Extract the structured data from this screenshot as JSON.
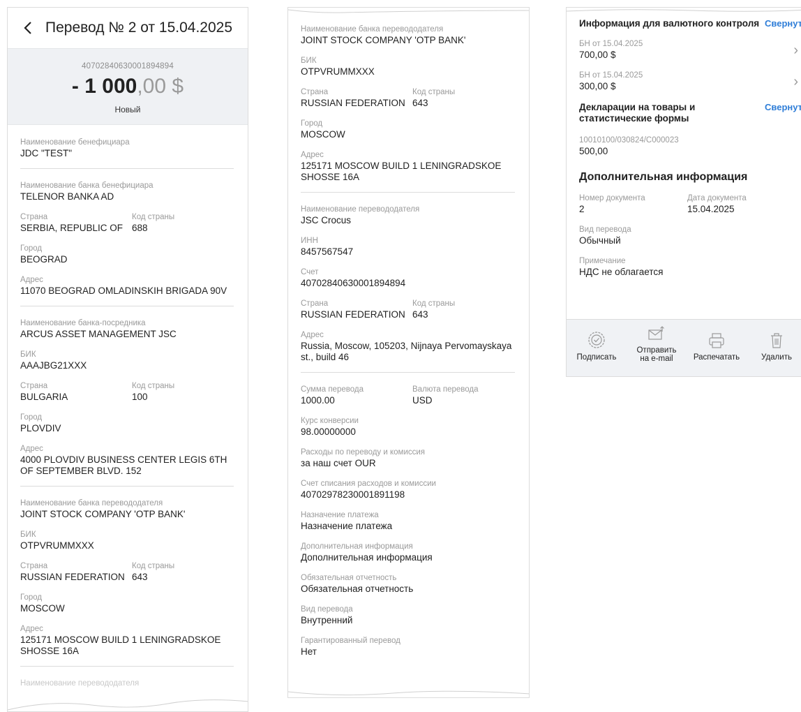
{
  "panel1": {
    "title": "Перевод № 2 от 15.04.2025",
    "account": "40702840630001894894",
    "amount_int": "- 1 000",
    "amount_dec": ",00 $",
    "status": "Новый",
    "beneficiary_name": {
      "label": "Наименование бенефициара",
      "value": "JDC \"TEST\""
    },
    "beneficiary_bank": {
      "name": {
        "label": "Наименование банка бенефициара",
        "value": "TELENOR BANKA AD"
      },
      "country": {
        "label": "Страна",
        "value": "SERBIA, REPUBLIC OF"
      },
      "country_code": {
        "label": "Код страны",
        "value": "688"
      },
      "city": {
        "label": "Город",
        "value": "BEOGRAD"
      },
      "address": {
        "label": "Адрес",
        "value": "11070 BEOGRAD OMLADINSKIH BRIGADA 90V"
      }
    },
    "intermediary_bank": {
      "name": {
        "label": "Наименование банка-посредника",
        "value": "ARCUS ASSET MANAGEMENT JSC"
      },
      "bik": {
        "label": "БИК",
        "value": "AAAJBG21XXX"
      },
      "country": {
        "label": "Страна",
        "value": "BULGARIA"
      },
      "country_code": {
        "label": "Код страны",
        "value": "100"
      },
      "city": {
        "label": "Город",
        "value": "PLOVDIV"
      },
      "address": {
        "label": "Адрес",
        "value": "4000 PLOVDIV BUSINESS CENTER LEGIS 6TH OF SEPTEMBER BLVD. 152"
      }
    },
    "sender_bank": {
      "name": {
        "label": "Наименование банка перевододателя",
        "value": "JOINT STOCK COMPANY 'OTP BANK'"
      },
      "bik": {
        "label": "БИК",
        "value": "OTPVRUMMXXX"
      },
      "country": {
        "label": "Страна",
        "value": "RUSSIAN FEDERATION"
      },
      "country_code": {
        "label": "Код страны",
        "value": "643"
      },
      "city": {
        "label": "Город",
        "value": "MOSCOW"
      },
      "address": {
        "label": "Адрес",
        "value": "125171 MOSCOW BUILD 1 LENINGRADSKOE SHOSSE 16A"
      }
    },
    "next_label": "Наименование перевододателя"
  },
  "panel2": {
    "sender_bank": {
      "name": {
        "label": "Наименование банка перевододателя",
        "value": "JOINT STOCK COMPANY 'OTP BANK'"
      },
      "bik": {
        "label": "БИК",
        "value": "OTPVRUMMXXX"
      },
      "country": {
        "label": "Страна",
        "value": "RUSSIAN FEDERATION"
      },
      "country_code": {
        "label": "Код страны",
        "value": "643"
      },
      "city": {
        "label": "Город",
        "value": "MOSCOW"
      },
      "address": {
        "label": "Адрес",
        "value": "125171 MOSCOW BUILD 1 LENINGRADSKOE SHOSSE 16A"
      }
    },
    "sender": {
      "name": {
        "label": "Наименование перевододателя",
        "value": "JSC Crocus"
      },
      "inn": {
        "label": "ИНН",
        "value": "8457567547"
      },
      "account": {
        "label": "Счет",
        "value": "40702840630001894894"
      },
      "country": {
        "label": "Страна",
        "value": "RUSSIAN FEDERATION"
      },
      "country_code": {
        "label": "Код страны",
        "value": "643"
      },
      "address": {
        "label": "Адрес",
        "value": "Russia, Moscow, 105203, Nijnaya Pervomayskaya st., build 46"
      }
    },
    "transfer": {
      "amount": {
        "label": "Сумма перевода",
        "value": "1000.00"
      },
      "currency": {
        "label": "Валюта перевода",
        "value": "USD"
      },
      "rate": {
        "label": "Курс конверсии",
        "value": "98.00000000"
      },
      "fees": {
        "label": "Расходы по переводу и комиссия",
        "value": "за наш счет OUR"
      },
      "fee_account": {
        "label": "Счет списания расходов и комиссии",
        "value": "40702978230001891198"
      },
      "purpose": {
        "label": "Назначение платежа",
        "value": "Назначение платежа"
      },
      "additional": {
        "label": "Дополнительная информация",
        "value": "Дополнительная информация"
      },
      "mandatory": {
        "label": "Обязательная отчетность",
        "value": "Обязательная отчетность"
      },
      "kind": {
        "label": "Вид перевода",
        "value": "Внутренний"
      },
      "guaranteed": {
        "label": "Гарантированный перевод",
        "value": "Нет"
      }
    }
  },
  "panel3": {
    "currency_control": {
      "title": "Информация для валютного контроля",
      "collapse": "Свернуть",
      "items": [
        {
          "label": "БН от 15.04.2025",
          "value": "700,00 $"
        },
        {
          "label": "БН от 15.04.2025",
          "value": "300,00 $"
        }
      ]
    },
    "declarations": {
      "title": "Декларации на товары и статистические формы",
      "collapse": "Свернуть",
      "item": {
        "label": "10010100/030824/C000023",
        "value": "500,00"
      }
    },
    "additional_info": {
      "title": "Дополнительная информация",
      "doc_number": {
        "label": "Номер документа",
        "value": "2"
      },
      "doc_date": {
        "label": "Дата документа",
        "value": "15.04.2025"
      },
      "kind": {
        "label": "Вид перевода",
        "value": "Обычный"
      },
      "note": {
        "label": "Примечание",
        "value": "НДС не облагается"
      }
    },
    "actions": {
      "sign": "Подписать",
      "send_line1": "Отправить",
      "send_line2": "на e-mail",
      "print": "Распечатать",
      "delete": "Удалить"
    },
    "icons": [
      "sign-icon",
      "email-send-icon",
      "printer-icon",
      "trash-icon"
    ]
  }
}
